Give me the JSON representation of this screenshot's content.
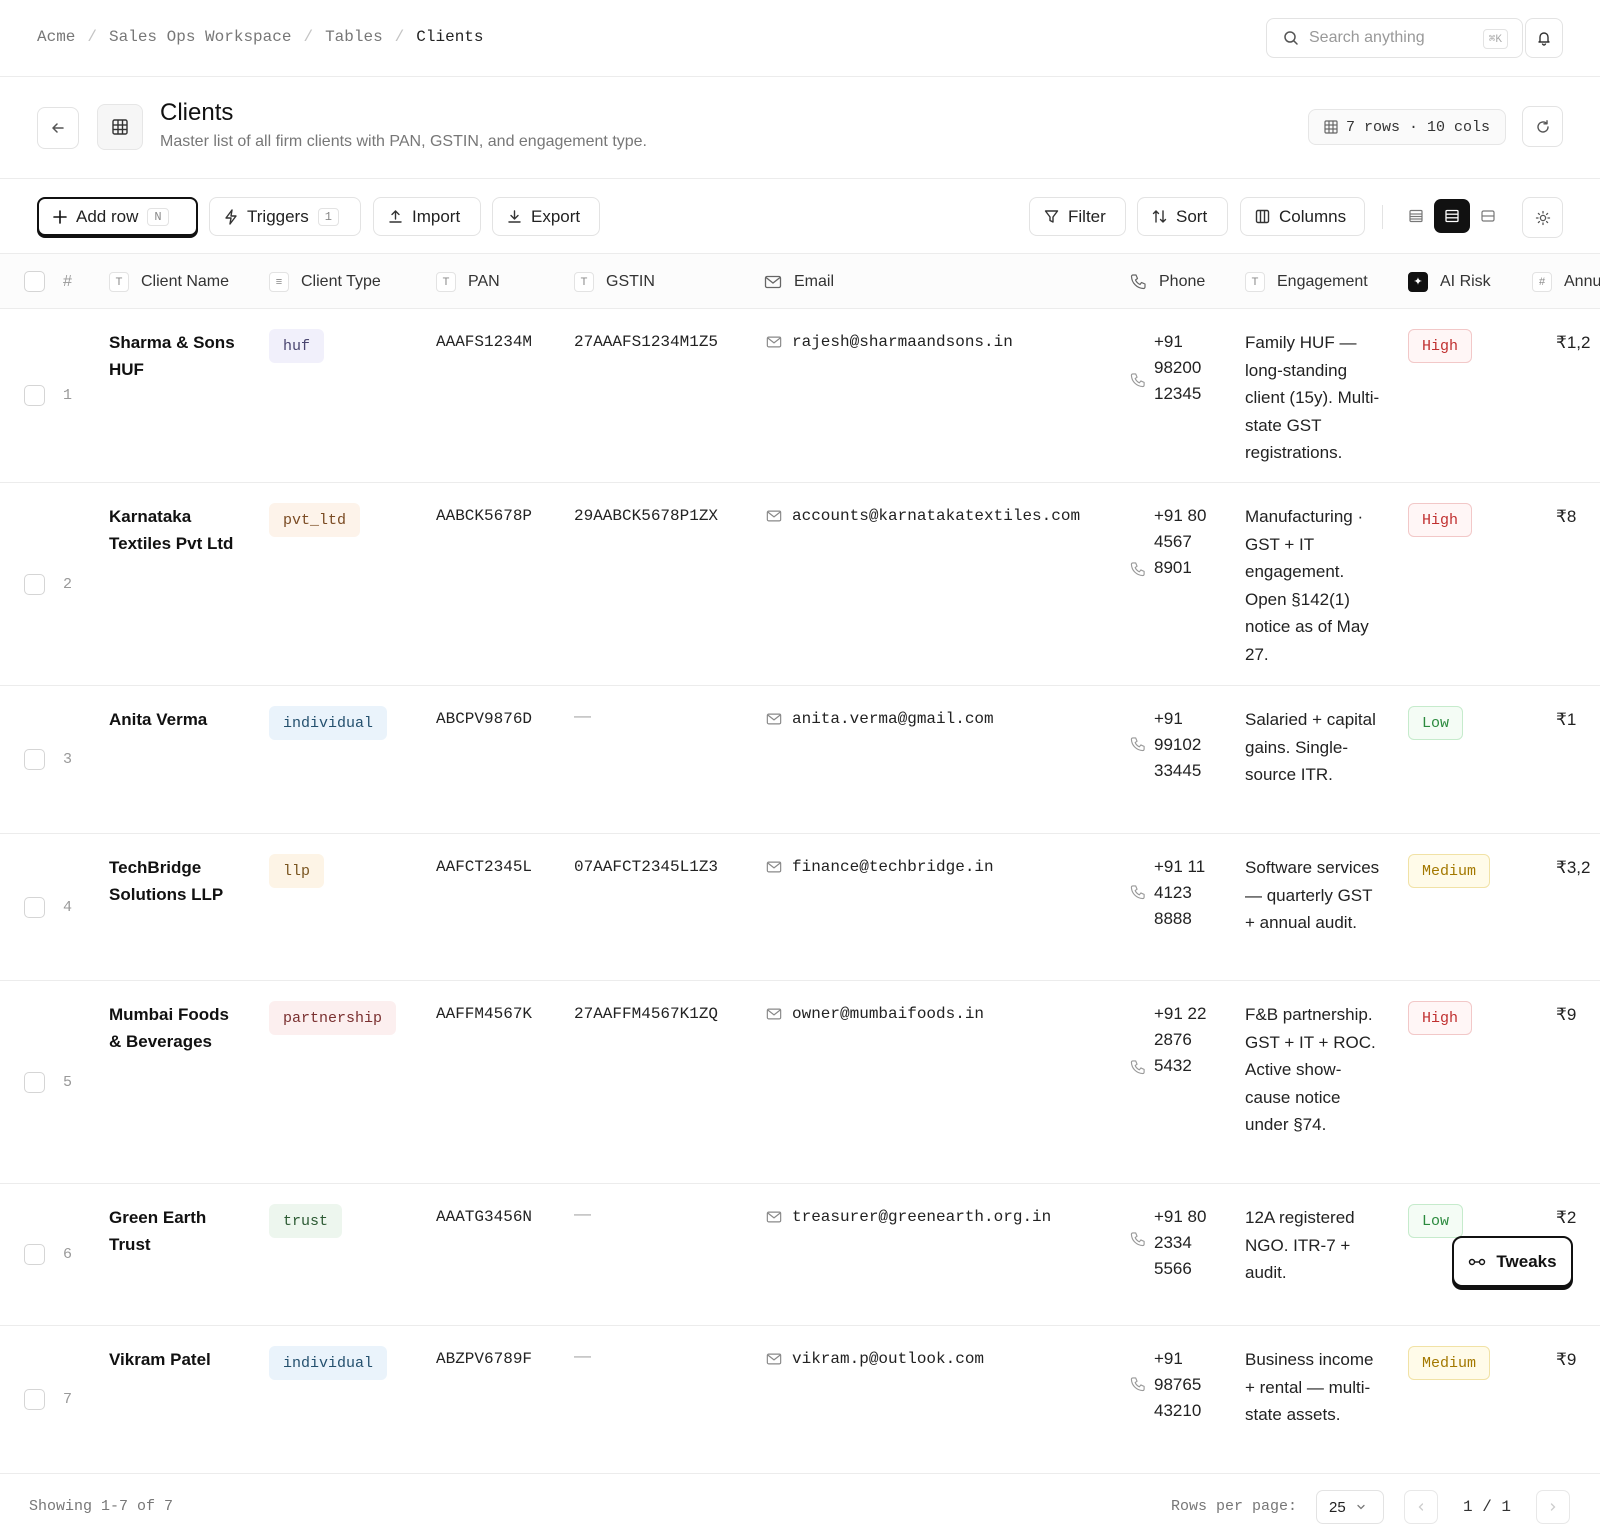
{
  "breadcrumb": [
    "Acme",
    "Sales Ops Workspace",
    "Tables",
    "Clients"
  ],
  "search": {
    "placeholder": "Search anything",
    "shortcut": "⌘K"
  },
  "page": {
    "title": "Clients",
    "subtitle": "Master list of all firm clients with PAN, GSTIN, and engagement type.",
    "meta": "7 rows · 10 cols"
  },
  "toolbar": {
    "add_row": "Add row",
    "add_row_key": "N",
    "triggers": "Triggers",
    "triggers_count": "1",
    "import": "Import",
    "export": "Export",
    "filter": "Filter",
    "sort": "Sort",
    "columns": "Columns"
  },
  "columns": {
    "num": "#",
    "name": "Client Name",
    "type": "Client Type",
    "pan": "PAN",
    "gstin": "GSTIN",
    "email": "Email",
    "phone": "Phone",
    "engagement": "Engagement",
    "ai_risk": "AI Risk",
    "annual": "Annu"
  },
  "column_icons": {
    "text": "T",
    "select": "≡",
    "number": "#",
    "ai": "✦"
  },
  "rows": [
    {
      "num": "1",
      "name": "Sharma & Sons HUF",
      "type": "huf",
      "pan": "AAAFS1234M",
      "gstin": "27AAAFS1234M1Z5",
      "email": "rajesh@sharmaandsons.in",
      "phone": "+91 98200 12345",
      "engagement": "Family HUF — long-standing client (15y). Multi-state GST registrations.",
      "risk": "High",
      "annual": "₹1,2"
    },
    {
      "num": "2",
      "name": "Karnataka Textiles Pvt Ltd",
      "type": "pvt_ltd",
      "pan": "AABCK5678P",
      "gstin": "29AABCK5678P1ZX",
      "email": "accounts@karnatakatextiles.com",
      "phone": "+91 80 4567 8901",
      "engagement": "Manufacturing · GST + IT engagement. Open §142(1) notice as of May 27.",
      "risk": "High",
      "annual": "₹8"
    },
    {
      "num": "3",
      "name": "Anita Verma",
      "type": "individual",
      "pan": "ABCPV9876D",
      "gstin": "—",
      "email": "anita.verma@gmail.com",
      "phone": "+91 99102 33445",
      "engagement": "Salaried + capital gains. Single-source ITR.",
      "risk": "Low",
      "annual": "₹1"
    },
    {
      "num": "4",
      "name": "TechBridge Solutions LLP",
      "type": "llp",
      "pan": "AAFCT2345L",
      "gstin": "07AAFCT2345L1Z3",
      "email": "finance@techbridge.in",
      "phone": "+91 11 4123 8888",
      "engagement": "Software services — quarterly GST + annual audit.",
      "risk": "Medium",
      "annual": "₹3,2"
    },
    {
      "num": "5",
      "name": "Mumbai Foods & Beverages",
      "type": "partnership",
      "pan": "AAFFM4567K",
      "gstin": "27AAFFM4567K1ZQ",
      "email": "owner@mumbaifoods.in",
      "phone": "+91 22 2876 5432",
      "engagement": "F&B partnership. GST + IT + ROC. Active show-cause notice under §74.",
      "risk": "High",
      "annual": "₹9"
    },
    {
      "num": "6",
      "name": "Green Earth Trust",
      "type": "trust",
      "pan": "AAATG3456N",
      "gstin": "—",
      "email": "treasurer@greenearth.org.in",
      "phone": "+91 80 2334 5566",
      "engagement": "12A registered NGO. ITR-7 + audit.",
      "risk": "Low",
      "annual": "₹2"
    },
    {
      "num": "7",
      "name": "Vikram Patel",
      "type": "individual",
      "pan": "ABZPV6789F",
      "gstin": "—",
      "email": "vikram.p@outlook.com",
      "phone": "+91 98765 43210",
      "engagement": "Business income + rental — multi-state assets.",
      "risk": "Medium",
      "annual": "₹9"
    }
  ],
  "tag_colors": {
    "huf": {
      "bg": "#f1f0fb",
      "fg": "#4a4670"
    },
    "pvt_ltd": {
      "bg": "#fdf3ea",
      "fg": "#7a4a22"
    },
    "individual": {
      "bg": "#eaf3fb",
      "fg": "#24506e"
    },
    "llp": {
      "bg": "#fdf4e6",
      "fg": "#7a5520"
    },
    "partnership": {
      "bg": "#fcefef",
      "fg": "#7a3030"
    },
    "trust": {
      "bg": "#edf6ee",
      "fg": "#2c5a33"
    }
  },
  "risk_colors": {
    "High": {
      "bg": "#fff6f6",
      "fg": "#c03030",
      "border": "#f2c8c8"
    },
    "Low": {
      "bg": "#f4fcf5",
      "fg": "#2b8a3e",
      "border": "#c6ebcc"
    },
    "Medium": {
      "bg": "#fffbe9",
      "fg": "#a37800",
      "border": "#f1e2a6"
    }
  },
  "footer": {
    "showing": "Showing 1-7 of 7",
    "rows_per_page_label": "Rows per page:",
    "rows_per_page": "25",
    "page_indicator": "1 / 1"
  },
  "tweaks_label": "Tweaks"
}
